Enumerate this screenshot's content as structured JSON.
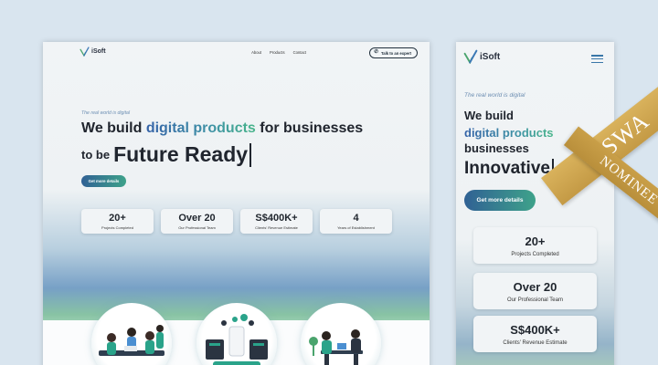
{
  "brand": {
    "name": "iSoft"
  },
  "nav": {
    "links": [
      "About",
      "Products",
      "Contact"
    ],
    "cta_label": "Talk to an expert"
  },
  "hero": {
    "tagline": "The real world is digital",
    "line1_pre": "We build ",
    "line1_accent": "digital products",
    "line1_post": " for businesses",
    "line2_pre": "to be",
    "line2_word": "Future Ready",
    "cta": "Get more details"
  },
  "stats": [
    {
      "value": "20+",
      "label": "Projects Completed"
    },
    {
      "value": "Over 20",
      "label": "Our Professional Team"
    },
    {
      "value": "S$400K+",
      "label": "Clients' Revenue Estimate"
    },
    {
      "value": "4",
      "label": "Years of Establishment"
    }
  ],
  "mobile": {
    "line1": "We build",
    "line2": "digital products",
    "line3": "businesses",
    "typed_word": "Innovative"
  },
  "ribbon": {
    "top": "SWA",
    "bottom": "NOMINEE"
  },
  "colors": {
    "accent_blue": "#3563a8",
    "accent_green": "#48b58a",
    "ribbon_gold": "#c9a04c",
    "background": "#d9e5ef"
  },
  "icons": [
    "isoft-logo-icon",
    "phone-icon",
    "hamburger-menu-icon"
  ]
}
